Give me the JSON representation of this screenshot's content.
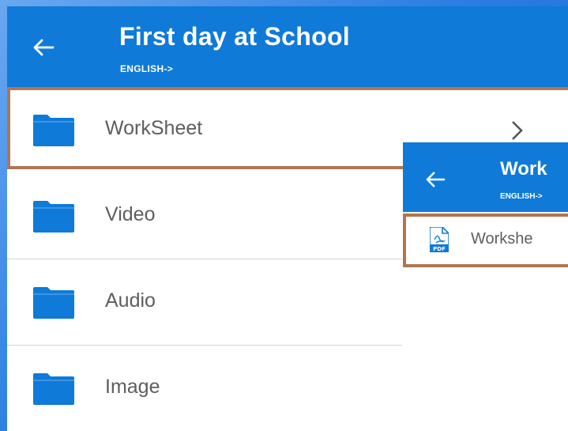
{
  "header": {
    "title": "First day at School",
    "subtitle": "ENGLISH->"
  },
  "folders": [
    {
      "label": "WorkSheet",
      "icon": "folder-icon",
      "highlighted": true,
      "has_chevron": true
    },
    {
      "label": "Video",
      "icon": "folder-icon"
    },
    {
      "label": "Audio",
      "icon": "folder-icon"
    },
    {
      "label": "Image",
      "icon": "folder-icon"
    }
  ],
  "overlay": {
    "title": "Work",
    "subtitle": "ENGLISH->",
    "file": {
      "label": "Workshe",
      "icon": "pdf-icon"
    }
  },
  "colors": {
    "appbar": "#0f7ad8",
    "folder": "#0f7ad8",
    "highlight_border": "#b07552",
    "text": "#5e5e5e"
  }
}
